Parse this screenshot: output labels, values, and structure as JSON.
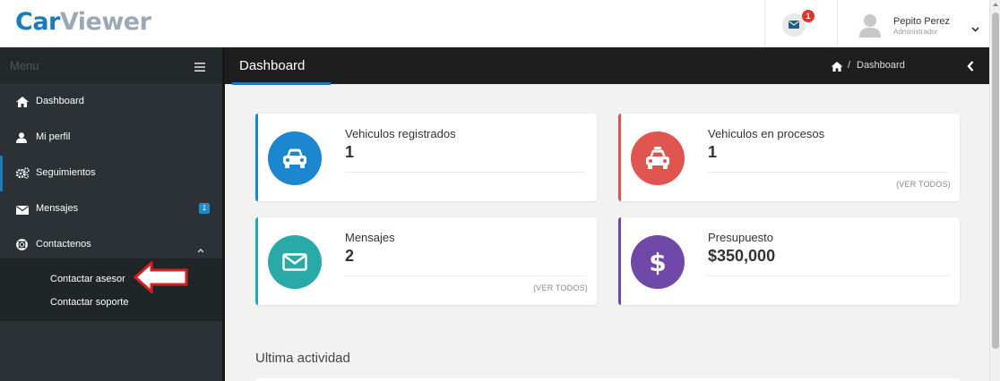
{
  "app": {
    "logo_part1": "Car",
    "logo_part2": "Viewer"
  },
  "header": {
    "message_count": "1",
    "user_name": "Pepito Perez",
    "user_role": "Administrador"
  },
  "sidebar": {
    "menu_label": "Menu",
    "items": [
      {
        "label": "Dashboard",
        "icon": "home-icon"
      },
      {
        "label": "Mi perfil",
        "icon": "user-icon"
      },
      {
        "label": "Seguimientos",
        "icon": "gears-icon"
      },
      {
        "label": "Mensajes",
        "icon": "envelope-icon",
        "badge": "1"
      },
      {
        "label": "Contactenos",
        "icon": "life-ring-icon"
      }
    ],
    "submenu": [
      {
        "label": "Contactar asesor"
      },
      {
        "label": "Contactar soporte"
      }
    ]
  },
  "page": {
    "title": "Dashboard",
    "breadcrumb_sep": "/",
    "breadcrumb": "Dashboard"
  },
  "cards": [
    {
      "title": "Vehiculos registrados",
      "value": "1",
      "footer": "",
      "color": "#1c86cf",
      "icon": "car-icon"
    },
    {
      "title": "Vehiculos en procesos",
      "value": "1",
      "footer": "(VER TODOS)",
      "color": "#e0554f",
      "icon": "taxi-icon"
    },
    {
      "title": "Mensajes",
      "value": "2",
      "footer": "(VER TODOS)",
      "color": "#2aa9a9",
      "icon": "envelope-icon"
    },
    {
      "title": "Presupuesto",
      "value": "$350,000",
      "footer": "",
      "color": "#6f48a8",
      "icon": "dollar-icon"
    }
  ],
  "section": {
    "title": "Ultima actividad"
  },
  "colors": {
    "brand_blue": "#1c7bb8",
    "sidebar_bg": "#2b3134",
    "pagebar_bg": "#1e1e1e",
    "badge_red": "#d9382f"
  }
}
